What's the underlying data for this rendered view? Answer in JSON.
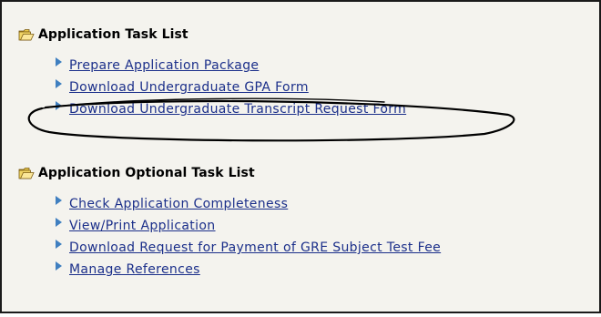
{
  "colors": {
    "panel_background": "#f4f3ee",
    "link": "#1b2f8a",
    "bullet": "#3f7fc0",
    "annotation_ellipse": "#000000"
  },
  "icons": {
    "section_icon": "open-folder-icon",
    "item_bullet": "triangle-right-icon"
  },
  "annotation": {
    "type": "hand-drawn-ellipse",
    "circles_item": "Download Undergraduate Transcript Request Form"
  },
  "sections": [
    {
      "title": "Application Task List",
      "items": [
        {
          "label": "Prepare Application Package"
        },
        {
          "label": "Download Undergraduate GPA Form"
        },
        {
          "label": "Download Undergraduate Transcript Request Form"
        }
      ]
    },
    {
      "title": "Application Optional Task List",
      "items": [
        {
          "label": "Check Application Completeness"
        },
        {
          "label": "View/Print Application"
        },
        {
          "label": "Download Request for Payment of GRE Subject Test Fee"
        },
        {
          "label": "Manage References"
        }
      ]
    }
  ]
}
